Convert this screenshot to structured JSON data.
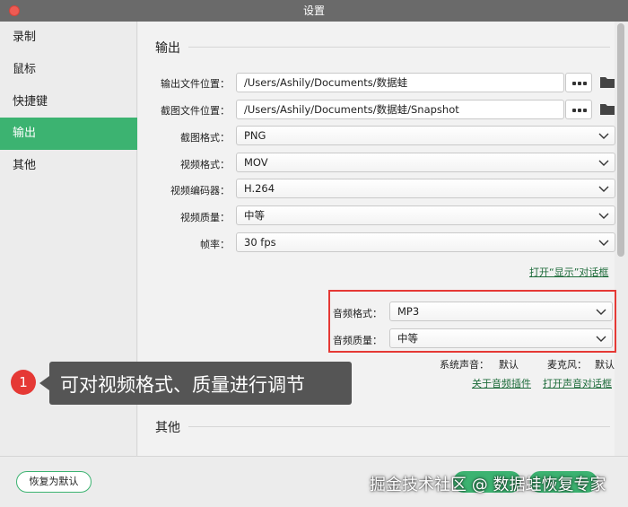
{
  "window": {
    "title": "设置"
  },
  "sidebar": {
    "items": [
      {
        "label": "录制"
      },
      {
        "label": "鼠标"
      },
      {
        "label": "快捷键"
      },
      {
        "label": "输出"
      },
      {
        "label": "其他"
      }
    ]
  },
  "output": {
    "section_title": "输出",
    "output_location": {
      "label": "输出文件位置：",
      "value": "/Users/Ashily/Documents/数据蛙"
    },
    "screenshot_location": {
      "label": "截图文件位置：",
      "value": "/Users/Ashily/Documents/数据蛙/Snapshot"
    },
    "screenshot_format": {
      "label": "截图格式：",
      "value": "PNG"
    },
    "video_format": {
      "label": "视频格式：",
      "value": "MOV"
    },
    "video_encoder": {
      "label": "视频编码器：",
      "value": "H.264"
    },
    "video_quality": {
      "label": "视频质量：",
      "value": "中等"
    },
    "frame_rate": {
      "label": "帧率：",
      "value": "30 fps"
    },
    "display_link": "打开“显示”对话框",
    "audio_format": {
      "label": "音频格式：",
      "value": "MP3"
    },
    "audio_quality": {
      "label": "音频质量：",
      "value": "中等"
    },
    "system_sound": {
      "label": "系统声音：",
      "value": "默认"
    },
    "microphone": {
      "label": "麦克风：",
      "value": "默认"
    },
    "audio_plugin_link": "关于音频插件",
    "open_audio_link": "打开声音对话框"
  },
  "other": {
    "section_title": "其他"
  },
  "footer": {
    "reset_label": "恢复为默认",
    "watermark": "掘金技术社区 @ 数据蛙恢复专家"
  },
  "annotation": {
    "badge": "1",
    "text": "可对视频格式、质量进行调节"
  },
  "colors": {
    "accent": "#3cb371",
    "highlight": "#e53935",
    "link": "#1d6b3a"
  }
}
